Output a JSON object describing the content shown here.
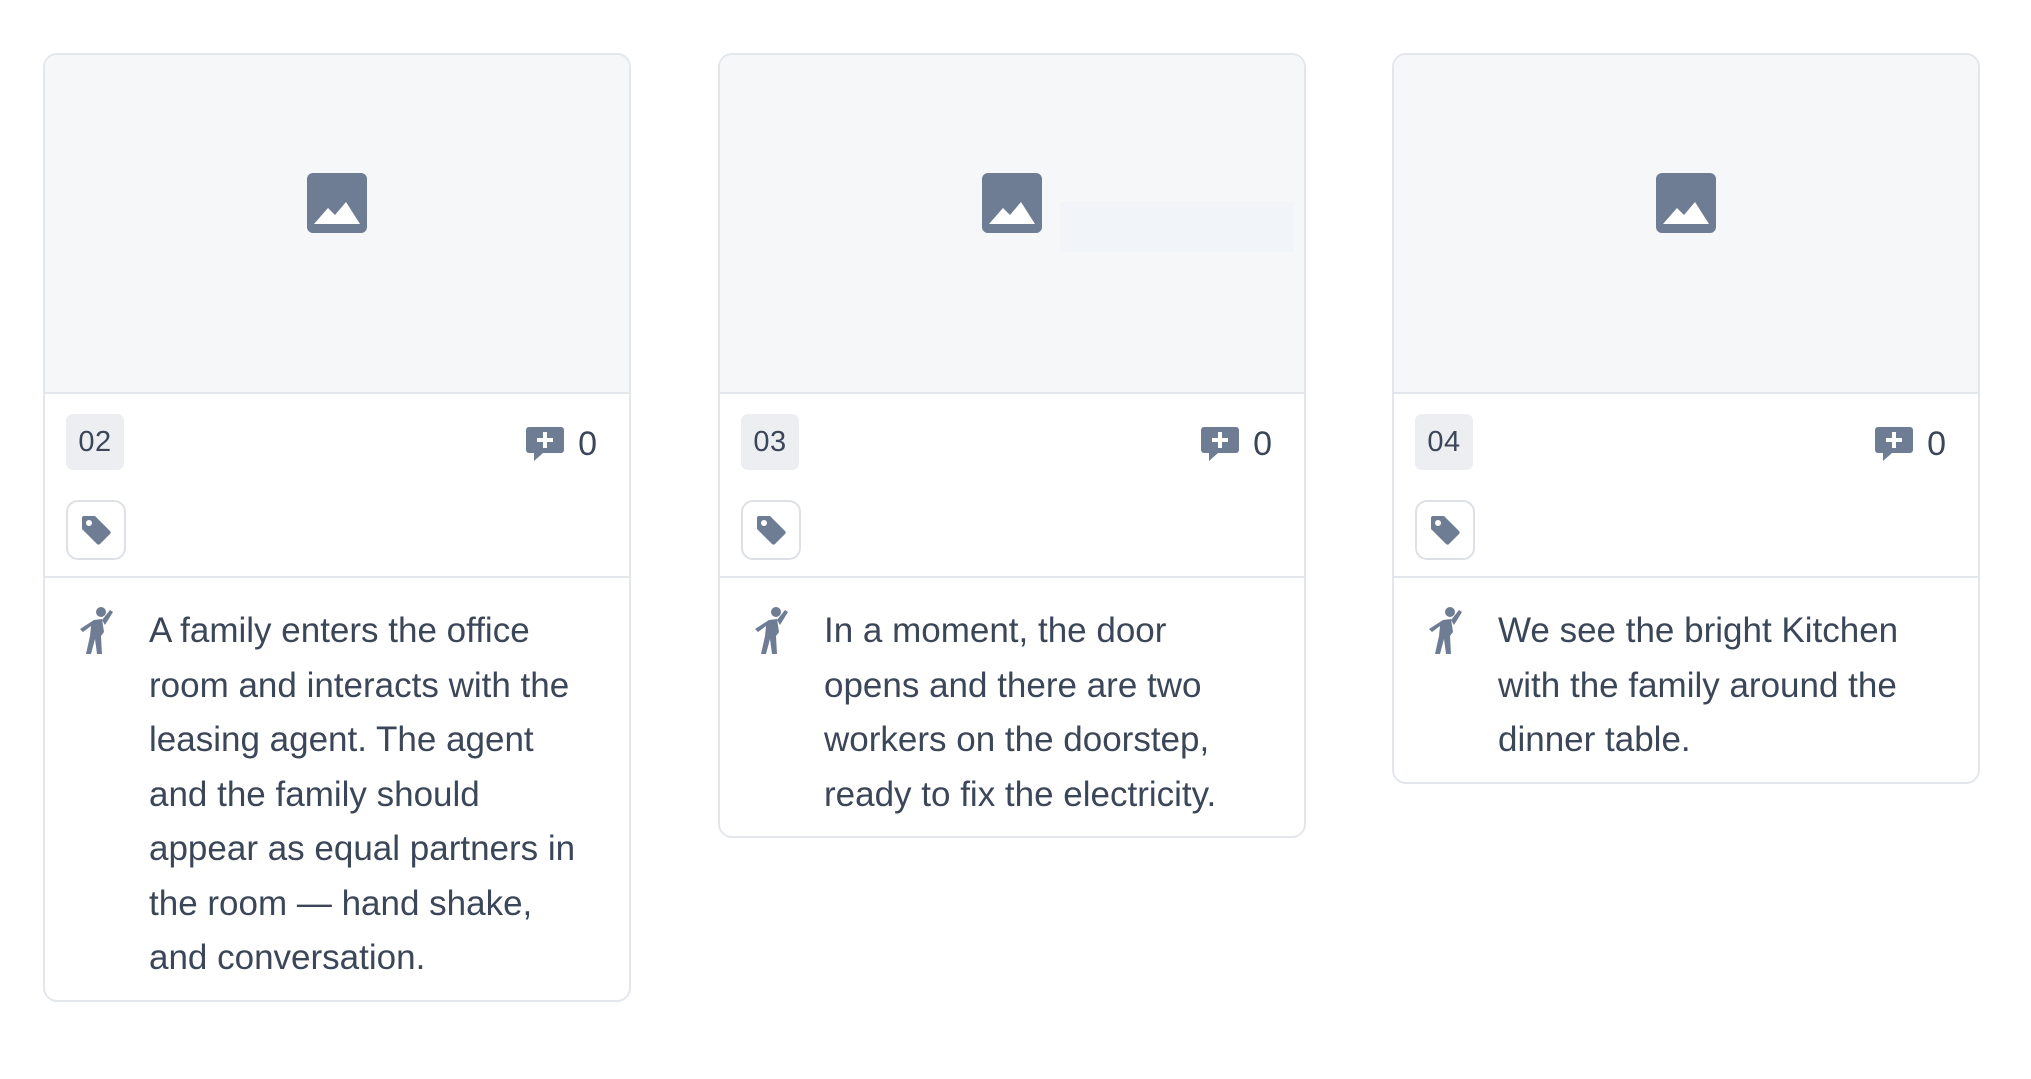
{
  "colors": {
    "card_border": "#e3e7ec",
    "thumb_bg": "#f6f7f9",
    "icon": "#6e7d93",
    "text": "#3b4658",
    "badge_bg": "#eceef2"
  },
  "frames": [
    {
      "number": "02",
      "comment_count": "0",
      "image_icon": "image-placeholder-icon",
      "comment_icon": "add-comment-icon",
      "tag_icon": "tag-icon",
      "action_icon": "action-figure-icon",
      "description": "A family enters the office room and interacts with the leasing agent. The agent and the family should appear as equal partners in the room — hand shake, and conversation."
    },
    {
      "number": "03",
      "comment_count": "0",
      "image_icon": "image-placeholder-icon",
      "comment_icon": "add-comment-icon",
      "tag_icon": "tag-icon",
      "action_icon": "action-figure-icon",
      "description": "In a moment, the door opens and there are two workers on the doorstep, ready to fix the electricity."
    },
    {
      "number": "04",
      "comment_count": "0",
      "image_icon": "image-placeholder-icon",
      "comment_icon": "add-comment-icon",
      "tag_icon": "tag-icon",
      "action_icon": "action-figure-icon",
      "description": "We see the bright Kitchen with the family around the dinner table."
    }
  ]
}
